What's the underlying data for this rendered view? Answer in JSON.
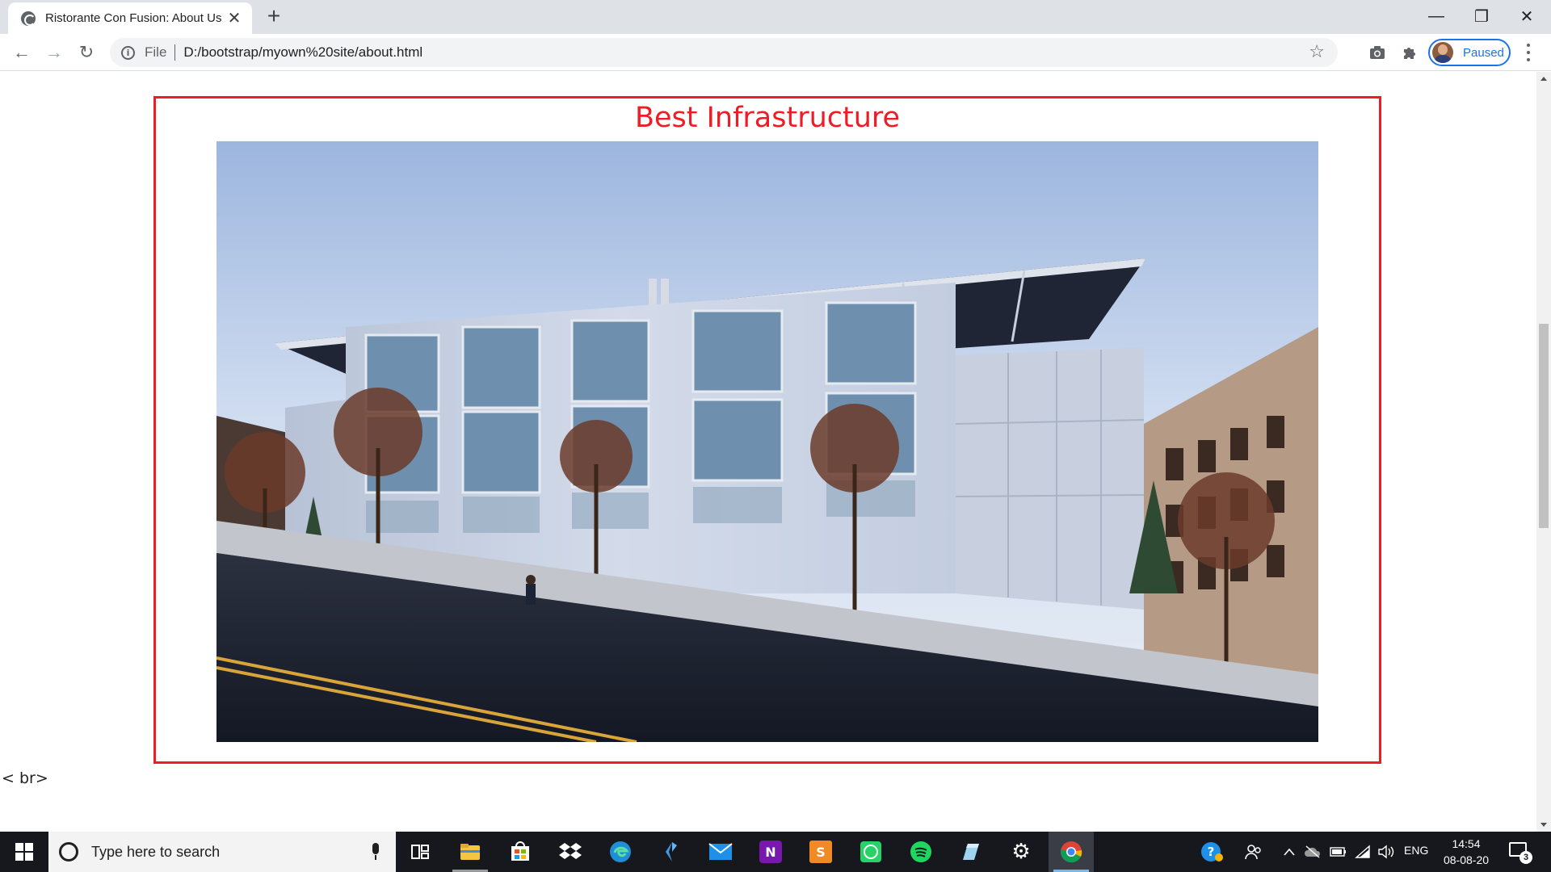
{
  "browser": {
    "tab": {
      "title": "Ristorante Con Fusion: About Us",
      "close_glyph": "✕"
    },
    "new_tab_glyph": "+",
    "window_controls": {
      "minimize": "—",
      "restore": "❐",
      "close": "✕"
    },
    "nav": {
      "back": "←",
      "forward": "→",
      "reload": "↻"
    },
    "omnibox": {
      "scheme_label": "File",
      "url": "D:/bootstrap/myown%20site/about.html"
    },
    "star_glyph": "☆",
    "extensions": {
      "camera_glyph": "📷",
      "puzzle_glyph": "🧩"
    },
    "profile": {
      "status": "Paused"
    }
  },
  "page": {
    "section_title": "Best Infrastructure",
    "stray_text": "< br>",
    "image": {
      "subject": "modern-building-with-solar-panels"
    }
  },
  "colors": {
    "accent_red": "#ee1c25",
    "profile_blue": "#1a73e8",
    "taskbar": "#16181d"
  },
  "taskbar": {
    "search_placeholder": "Type here to search",
    "apps": [
      {
        "name": "task-view",
        "glyph": "⧉"
      },
      {
        "name": "file-explorer",
        "glyph": ""
      },
      {
        "name": "microsoft-store",
        "glyph": ""
      },
      {
        "name": "dropbox",
        "glyph": ""
      },
      {
        "name": "edge",
        "glyph": "e"
      },
      {
        "name": "visual-studio",
        "glyph": ""
      },
      {
        "name": "mail",
        "glyph": ""
      },
      {
        "name": "onenote",
        "glyph": "N"
      },
      {
        "name": "sublime-text",
        "glyph": "S"
      },
      {
        "name": "whatsapp",
        "glyph": ""
      },
      {
        "name": "spotify",
        "glyph": ""
      },
      {
        "name": "notes",
        "glyph": ""
      },
      {
        "name": "settings",
        "glyph": "⚙"
      },
      {
        "name": "chrome",
        "glyph": ""
      }
    ],
    "tray": {
      "language": "ENG",
      "time": "14:54",
      "date": "08-08-20",
      "notification_count": "3"
    }
  }
}
